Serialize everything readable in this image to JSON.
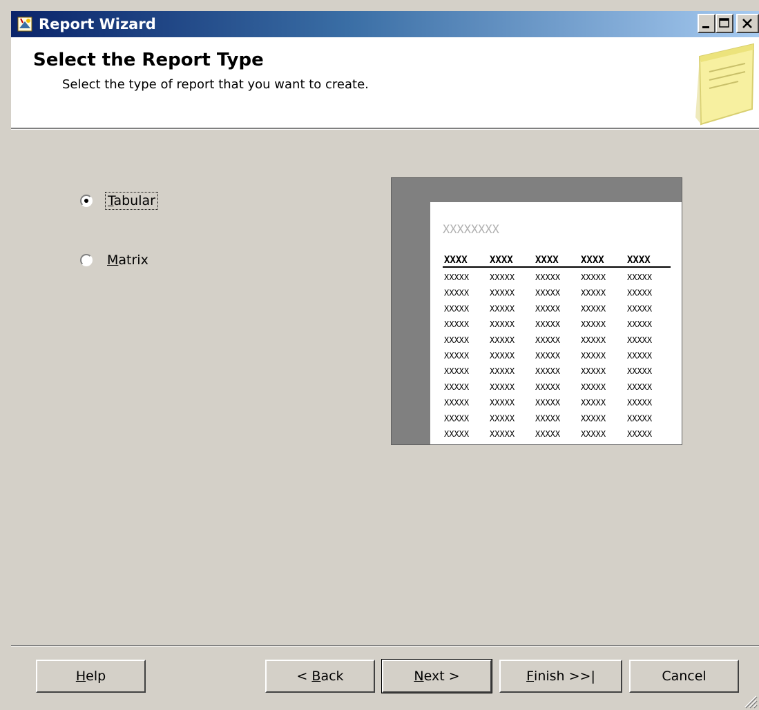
{
  "window": {
    "title": "Report Wizard",
    "icon": "wizard-icon",
    "controls": [
      "minimize-icon",
      "maximize-icon",
      "close-icon"
    ]
  },
  "header": {
    "title": "Select the Report Type",
    "subtitle": "Select the type of report that you want to create.",
    "icon": "report-note-icon"
  },
  "options": [
    {
      "label_mnemonic": "T",
      "label_rest": "abular",
      "selected": true
    },
    {
      "label_mnemonic": "M",
      "label_rest": "atrix",
      "selected": false
    }
  ],
  "preview": {
    "title_placeholder": "XXXXXXXX",
    "header_cells": [
      "XXXX",
      "XXXX",
      "XXXX",
      "XXXX",
      "XXXX"
    ],
    "row_cell": "XXXXX"
  },
  "buttons": {
    "help_mnemonic": "H",
    "help_rest": "elp",
    "back_prefix": "< ",
    "back_mnemonic": "B",
    "back_rest": "ack",
    "next_mnemonic": "N",
    "next_rest": "ext >",
    "finish_mnemonic": "F",
    "finish_rest": "inish >>|",
    "cancel": "Cancel"
  },
  "colors": {
    "titlebar_start": "#0a246a",
    "titlebar_end": "#a6caf0",
    "dialog_face": "#d4d0c8"
  }
}
